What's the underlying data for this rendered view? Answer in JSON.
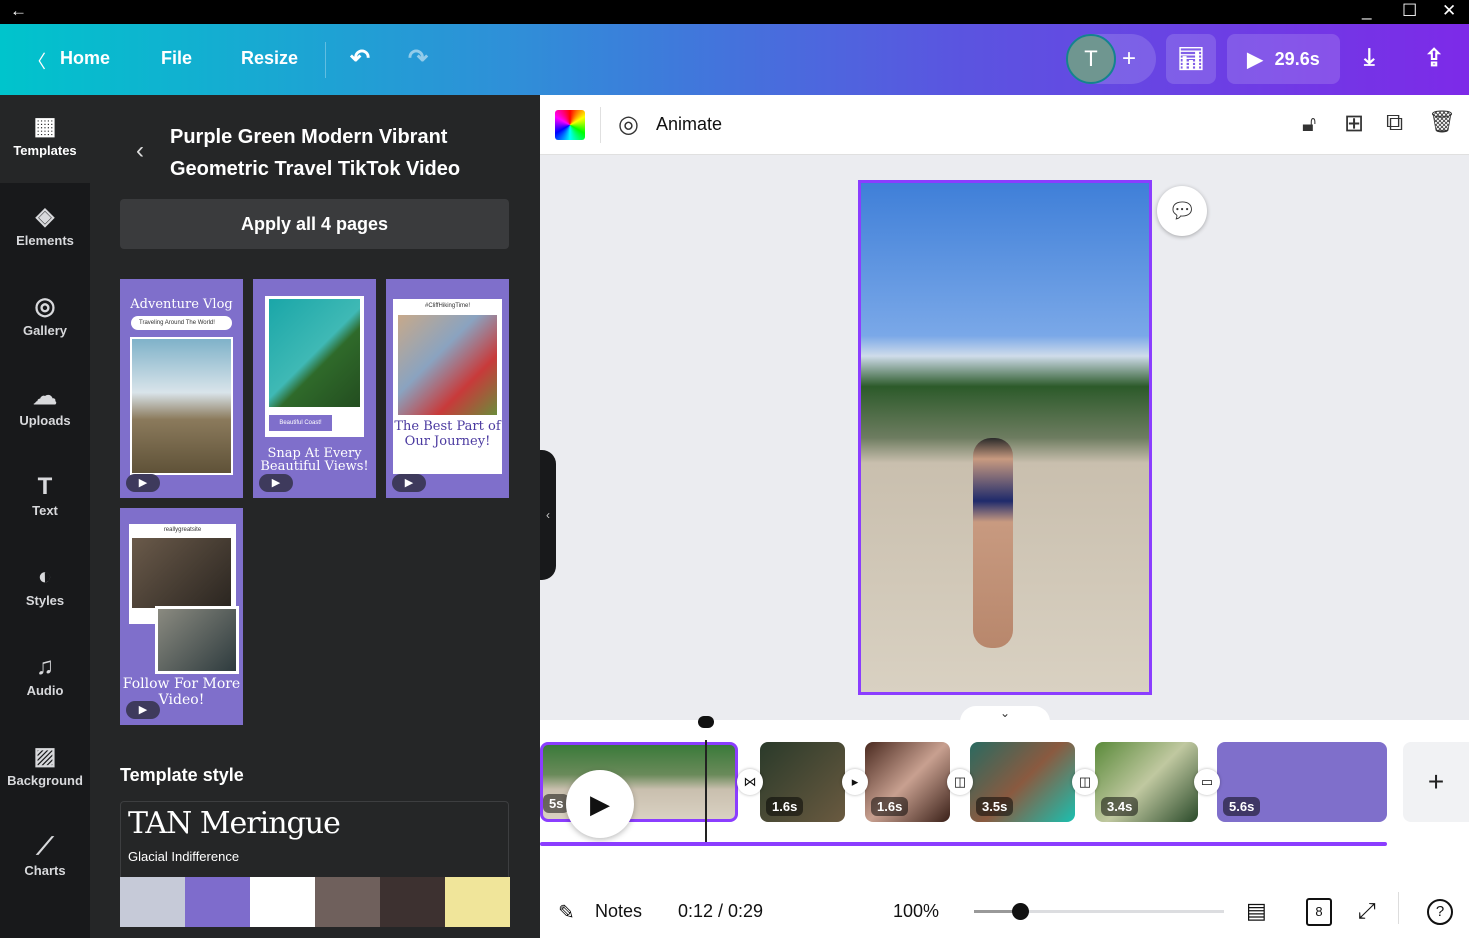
{
  "titlebar": {
    "back_icon": "←",
    "minimize": "_",
    "maximize": "☐",
    "close": "✕"
  },
  "header": {
    "home": "Home",
    "file": "File",
    "resize": "Resize",
    "avatar_letter": "T",
    "duration": "29.6s"
  },
  "rail": [
    {
      "label": "Templates",
      "icon": "▦"
    },
    {
      "label": "Elements",
      "icon": "◈"
    },
    {
      "label": "Gallery",
      "icon": "◎"
    },
    {
      "label": "Uploads",
      "icon": "☁"
    },
    {
      "label": "Text",
      "icon": "T"
    },
    {
      "label": "Styles",
      "icon": "◐"
    },
    {
      "label": "Audio",
      "icon": "♫"
    },
    {
      "label": "Background",
      "icon": "▨"
    },
    {
      "label": "Charts",
      "icon": "⟋"
    }
  ],
  "panel": {
    "title": "Purple Green Modern Vibrant Geometric Travel TikTok Video",
    "apply_button": "Apply all 4 pages",
    "thumbnails": [
      {
        "title": "Adventure Vlog",
        "subtitle": "Traveling Around The World!"
      },
      {
        "title": "Snap At Every Beautiful Views!",
        "subtitle": "Beautiful Coast!"
      },
      {
        "title": "The Best Part of Our Journey!",
        "subtitle": "#CliffHikingTime!"
      },
      {
        "title": "Follow For More Video!",
        "subtitle": "reallygreatsite"
      }
    ],
    "template_style_heading": "Template style",
    "style_font": "TAN Meringue",
    "style_subfont": "Glacial Indifference",
    "palette": [
      "#c6cad8",
      "#7e6ccc",
      "#ffffff",
      "#6f605c",
      "#3d3130",
      "#f0e59a"
    ]
  },
  "toolbar": {
    "animate": "Animate"
  },
  "timeline": {
    "clips": [
      {
        "duration": "5s"
      },
      {
        "duration": "1.6s"
      },
      {
        "duration": "1.6s"
      },
      {
        "duration": "3.5s"
      },
      {
        "duration": "3.4s"
      },
      {
        "duration": "5.6s"
      }
    ]
  },
  "bottombar": {
    "notes": "Notes",
    "time": "0:12 / 0:29",
    "zoom": "100%",
    "zoom_level_percent": 100,
    "pages": "8"
  },
  "colors": {
    "accent": "#8b3dff"
  }
}
